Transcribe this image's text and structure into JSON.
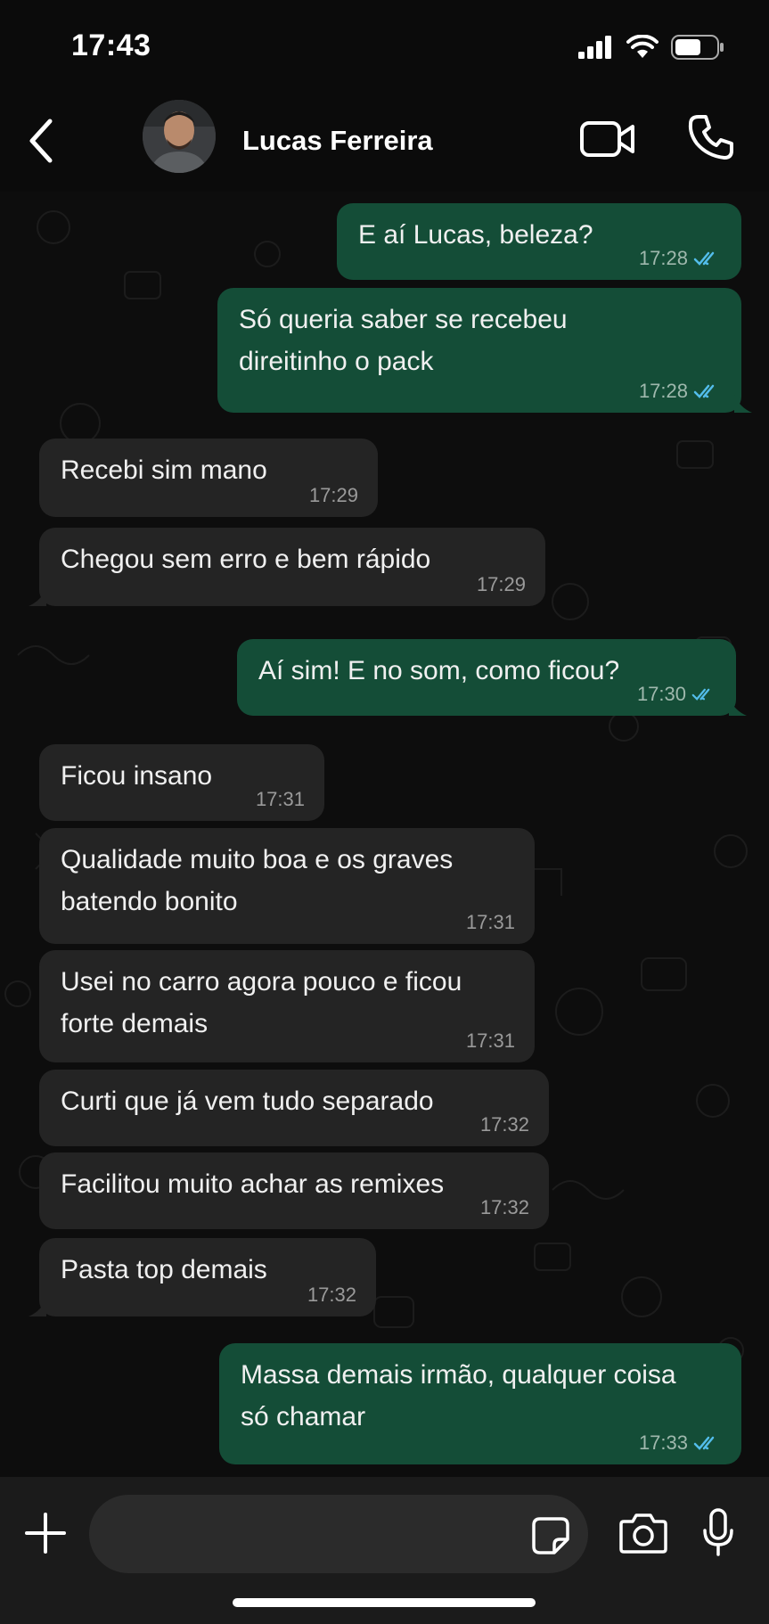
{
  "status_bar": {
    "time": "17:43"
  },
  "header": {
    "contact_name": "Lucas Ferreira"
  },
  "messages": [
    {
      "dir": "out",
      "text": "E aí Lucas, beleza?",
      "time": "17:28",
      "read": true
    },
    {
      "dir": "out",
      "text": "Só queria saber se recebeu direitinho o pack",
      "time": "17:28",
      "read": true
    },
    {
      "dir": "in",
      "text": "Recebi sim mano",
      "time": "17:29"
    },
    {
      "dir": "in",
      "text": "Chegou sem erro e bem rápido",
      "time": "17:29"
    },
    {
      "dir": "out",
      "text": "Aí sim! E no som, como ficou?",
      "time": "17:30",
      "read": true
    },
    {
      "dir": "in",
      "text": "Ficou insano",
      "time": "17:31"
    },
    {
      "dir": "in",
      "text": "Qualidade muito boa e os graves batendo bonito",
      "time": "17:31"
    },
    {
      "dir": "in",
      "text": "Usei no carro agora pouco e ficou forte demais",
      "time": "17:31"
    },
    {
      "dir": "in",
      "text": "Curti que já vem tudo separado",
      "time": "17:32"
    },
    {
      "dir": "in",
      "text": "Facilitou muito achar as remixes",
      "time": "17:32"
    },
    {
      "dir": "in",
      "text": "Pasta top demais",
      "time": "17:32"
    },
    {
      "dir": "out",
      "text": "Massa demais irmão, qualquer coisa só chamar",
      "time": "17:33",
      "read": true
    }
  ],
  "composer": {
    "value": "",
    "placeholder": ""
  },
  "colors": {
    "outgoing_bubble": "#144d37",
    "incoming_bubble": "#242424",
    "read_ticks": "#53bdeb",
    "background": "#0b0b0b"
  },
  "icons": [
    "back-icon",
    "video-call-icon",
    "phone-icon",
    "plus-icon",
    "sticker-icon",
    "camera-icon",
    "mic-icon",
    "double-check-icon"
  ]
}
